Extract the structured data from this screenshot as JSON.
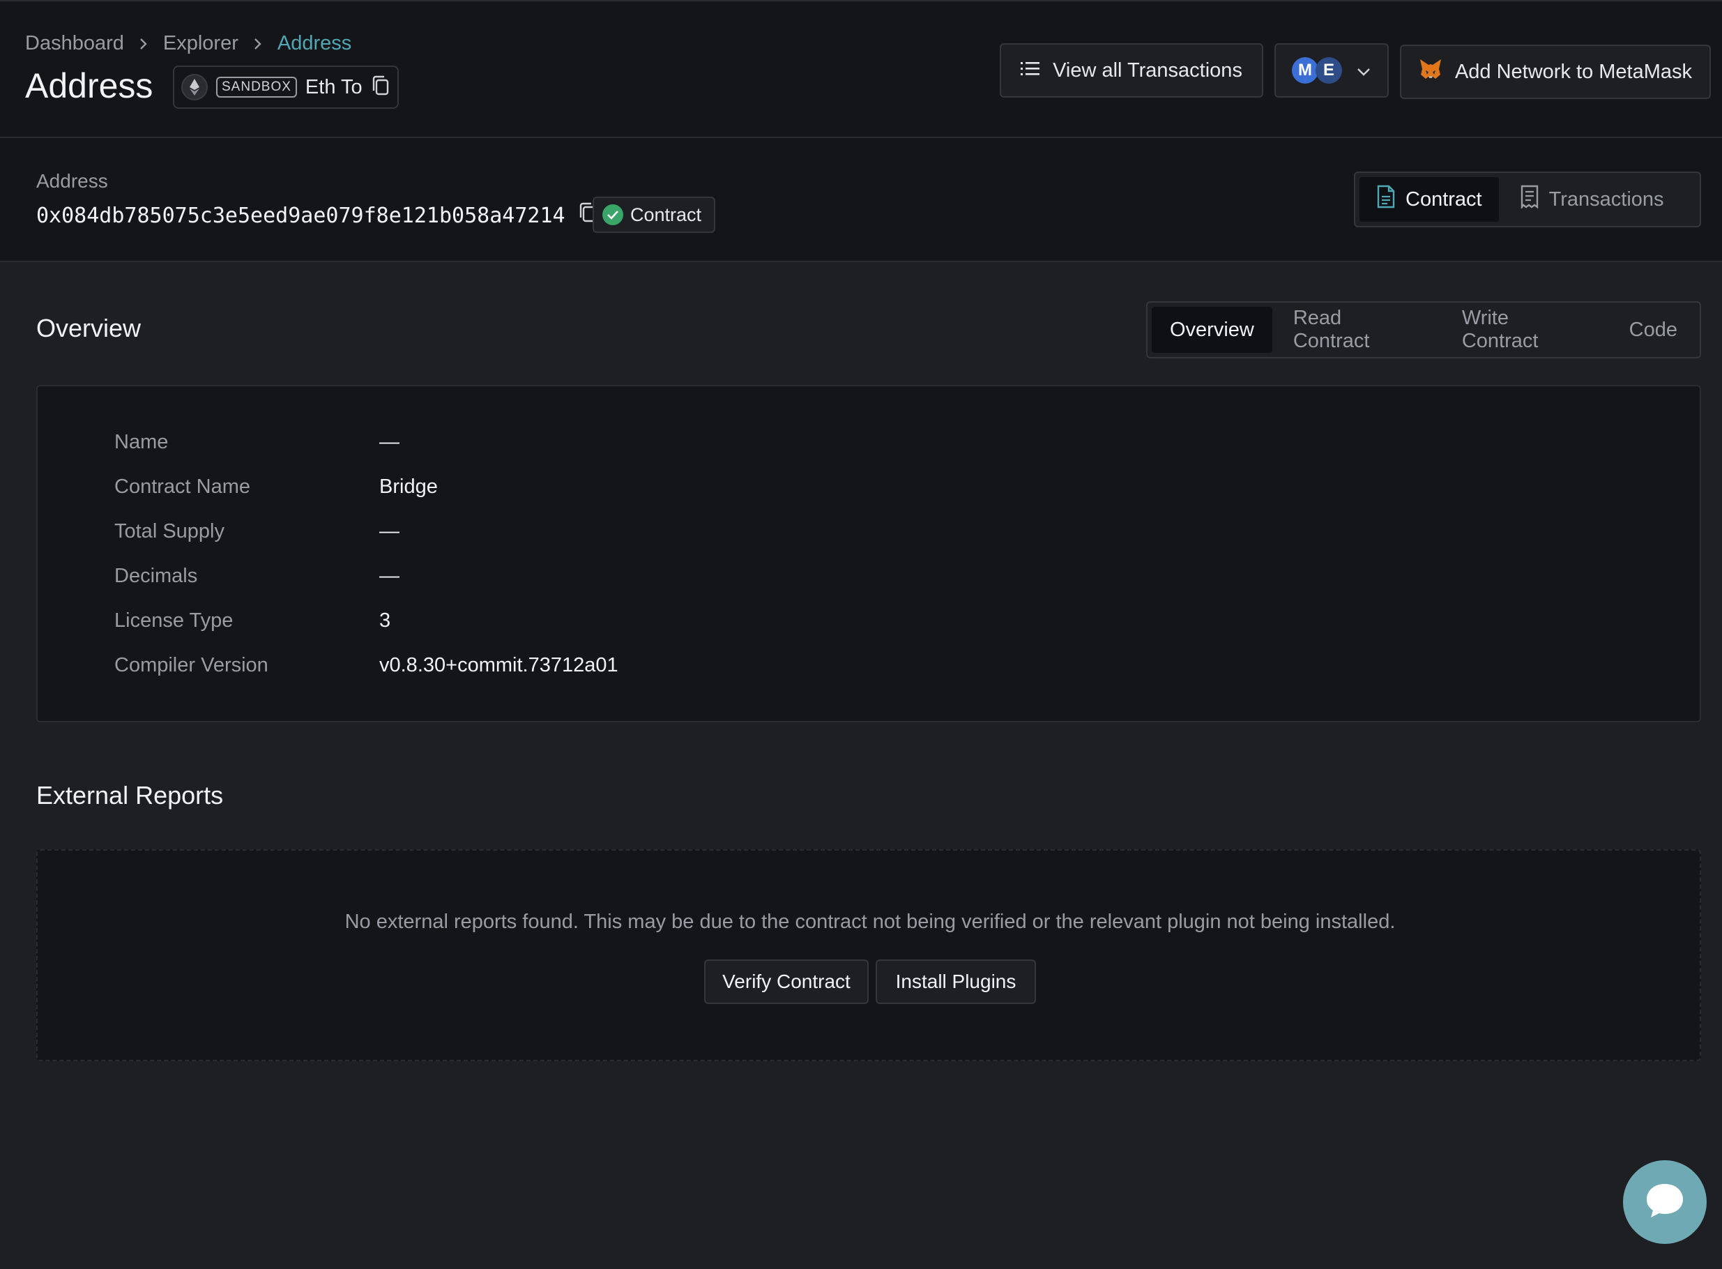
{
  "breadcrumb": {
    "items": [
      "Dashboard",
      "Explorer"
    ],
    "current": "Address"
  },
  "header": {
    "title": "Address",
    "chain": {
      "badge": "SANDBOX",
      "name": "Eth To"
    },
    "view_all_tx_label": "View all Transactions",
    "network_icons": [
      "M",
      "E"
    ],
    "add_network_label": "Add Network to MetaMask"
  },
  "address": {
    "label": "Address",
    "value": "0x084db785075c3e5eed9ae079f8e121b058a47214",
    "type_badge": "Contract",
    "views": [
      {
        "label": "Contract",
        "icon": "document-icon",
        "active": true
      },
      {
        "label": "Transactions",
        "icon": "receipt-icon",
        "active": false
      }
    ]
  },
  "overview": {
    "title": "Overview",
    "tabs": [
      {
        "label": "Overview",
        "active": true
      },
      {
        "label": "Read Contract",
        "active": false
      },
      {
        "label": "Write Contract",
        "active": false
      },
      {
        "label": "Code",
        "active": false
      }
    ],
    "rows": [
      {
        "key": "Name",
        "value": "—"
      },
      {
        "key": "Contract Name",
        "value": "Bridge"
      },
      {
        "key": "Total Supply",
        "value": "—"
      },
      {
        "key": "Decimals",
        "value": "—"
      },
      {
        "key": "License Type",
        "value": "3"
      },
      {
        "key": "Compiler Version",
        "value": "v0.8.30+commit.73712a01"
      }
    ]
  },
  "external_reports": {
    "title": "External Reports",
    "message": "No external reports found. This may be due to the contract not being verified or the relevant plugin not being installed.",
    "verify_label": "Verify Contract",
    "install_label": "Install Plugins"
  },
  "colors": {
    "accent": "#4fa8b3",
    "success": "#3aa569",
    "background": "#1e1f23",
    "panel": "#141518",
    "chat": "#6fa9b3"
  }
}
